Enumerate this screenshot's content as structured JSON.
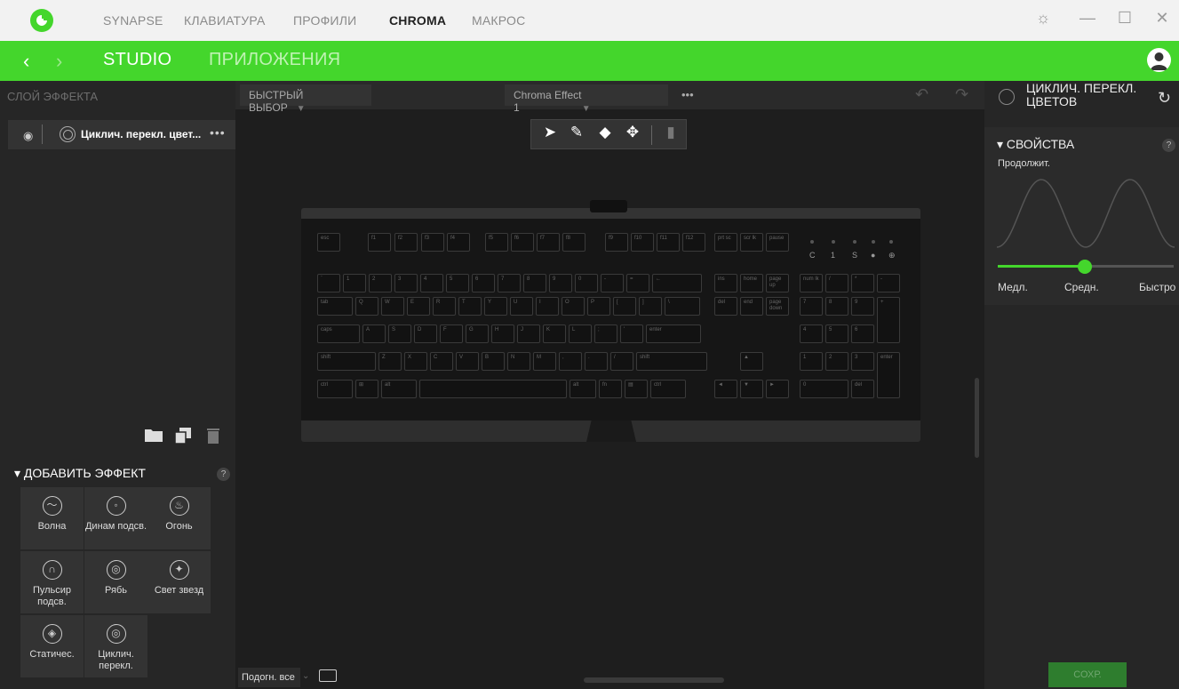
{
  "titlebar": {
    "tabs": [
      "SYNAPSE",
      "КЛАВИАТУРА",
      "ПРОФИЛИ",
      "CHROMA",
      "МАКРОС"
    ],
    "active_tab": "CHROMA",
    "logo_icon": "razer-logo-icon"
  },
  "subnav": {
    "back": "‹",
    "forward": "›",
    "tabs": [
      "STUDIO",
      "ПРИЛОЖЕНИЯ"
    ],
    "active": "STUDIO"
  },
  "layers": {
    "title": "СЛОЙ ЭФФЕКТА",
    "items": [
      {
        "name": "Циклич. перекл. цвет...",
        "visible": true
      }
    ]
  },
  "add_effect": {
    "title": "ДОБАВИТЬ ЭФФЕКТ",
    "help": "?",
    "effects": [
      {
        "label": "Волна",
        "icon": "wave-icon"
      },
      {
        "label": "Динам подсв.",
        "icon": "reactive-icon"
      },
      {
        "label": "Огонь",
        "icon": "fire-icon"
      },
      {
        "label": "Пульсир подсв.",
        "icon": "breathing-icon"
      },
      {
        "label": "Рябь",
        "icon": "ripple-icon"
      },
      {
        "label": "Свет звезд",
        "icon": "starlight-icon"
      },
      {
        "label": "Статичес.",
        "icon": "static-icon"
      },
      {
        "label": "Циклич. перекл.",
        "icon": "spectrum-cycling-icon"
      }
    ]
  },
  "center": {
    "quick_select": "БЫСТРЫЙ ВЫБОР",
    "effect_name": "Chroma Effect 1",
    "more": "•••",
    "fit_label": "Подогн. все"
  },
  "properties": {
    "effect_title": "ЦИКЛИЧ. ПЕРЕКЛ. ЦВЕТОВ",
    "section": "СВОЙСТВА",
    "help": "?",
    "duration_label": "Продолжит.",
    "speed": {
      "min": "Медл.",
      "mid": "Средн.",
      "max": "Быстро",
      "value": 0.5
    }
  },
  "save_label": "СОХР.",
  "colors": {
    "accent": "#44d62c"
  },
  "keyboard": {
    "fkeys": [
      "esc",
      "f1",
      "f2",
      "f3",
      "f4",
      "f5",
      "f6",
      "f7",
      "f8",
      "f9",
      "f10",
      "f11",
      "f12",
      "prt sc",
      "scr lk",
      "pause"
    ],
    "num_row": [
      "`",
      "1",
      "2",
      "3",
      "4",
      "5",
      "6",
      "7",
      "8",
      "9",
      "0",
      "-",
      "=",
      "←"
    ],
    "tab_row": [
      "tab",
      "Q",
      "W",
      "E",
      "R",
      "T",
      "Y",
      "U",
      "I",
      "O",
      "P",
      "[",
      "]",
      "\\"
    ],
    "caps_row": [
      "caps",
      "A",
      "S",
      "D",
      "F",
      "G",
      "H",
      "J",
      "K",
      "L",
      ";",
      "'",
      "enter"
    ],
    "shift_row": [
      "shift",
      "Z",
      "X",
      "C",
      "V",
      "B",
      "N",
      "M",
      ",",
      ".",
      "/",
      "shift"
    ],
    "ctrl_row": [
      "ctrl",
      "⊞",
      "alt",
      "",
      "alt",
      "fn",
      "▤",
      "ctrl"
    ],
    "nav_keys": [
      "ins",
      "home",
      "page up",
      "del",
      "end",
      "page down"
    ],
    "arrows": [
      "▲",
      "◄",
      "▼",
      "►"
    ],
    "numpad": [
      "num lk",
      "/",
      "*",
      "-",
      "7",
      "8",
      "9",
      "+",
      "4",
      "5",
      "6",
      "1",
      "2",
      "3",
      "enter",
      "0",
      "del"
    ],
    "leds": [
      "C",
      "1",
      "S",
      "●",
      "⊕"
    ]
  }
}
